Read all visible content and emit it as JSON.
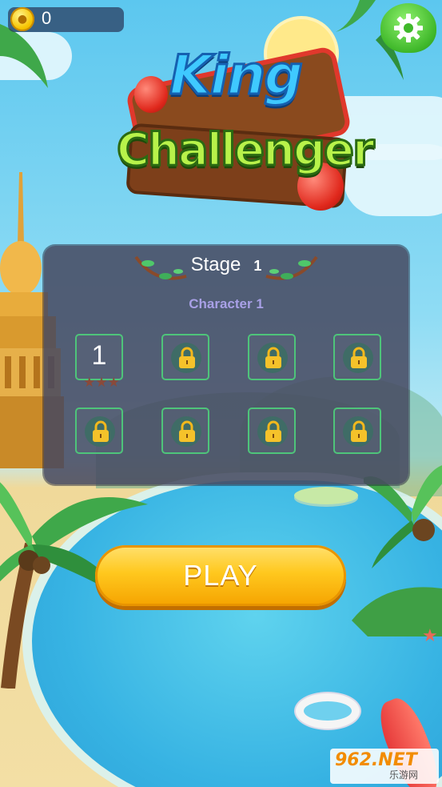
{
  "hud": {
    "coins": "0",
    "coin_icon": "coin-icon",
    "settings_icon": "gear-icon"
  },
  "logo": {
    "line1": "King",
    "line2": "Challenger"
  },
  "stage_panel": {
    "stage_label": "Stage",
    "stage_number": "1",
    "character_label": "Character 1",
    "levels": [
      {
        "label": "1",
        "locked": false,
        "stars": 3
      },
      {
        "label": "",
        "locked": true
      },
      {
        "label": "",
        "locked": true
      },
      {
        "label": "",
        "locked": true
      },
      {
        "label": "",
        "locked": true
      },
      {
        "label": "",
        "locked": true
      },
      {
        "label": "",
        "locked": true
      },
      {
        "label": "",
        "locked": true
      }
    ],
    "star_glyph": "★★★"
  },
  "play_button": {
    "label": "PLAY"
  },
  "watermark": {
    "big": "962.NET",
    "small": "乐游网"
  },
  "colors": {
    "panel": "#464860",
    "accent_green": "#4ec47a",
    "play_yellow": "#ffc81e",
    "char_label": "#a8a0e6"
  }
}
